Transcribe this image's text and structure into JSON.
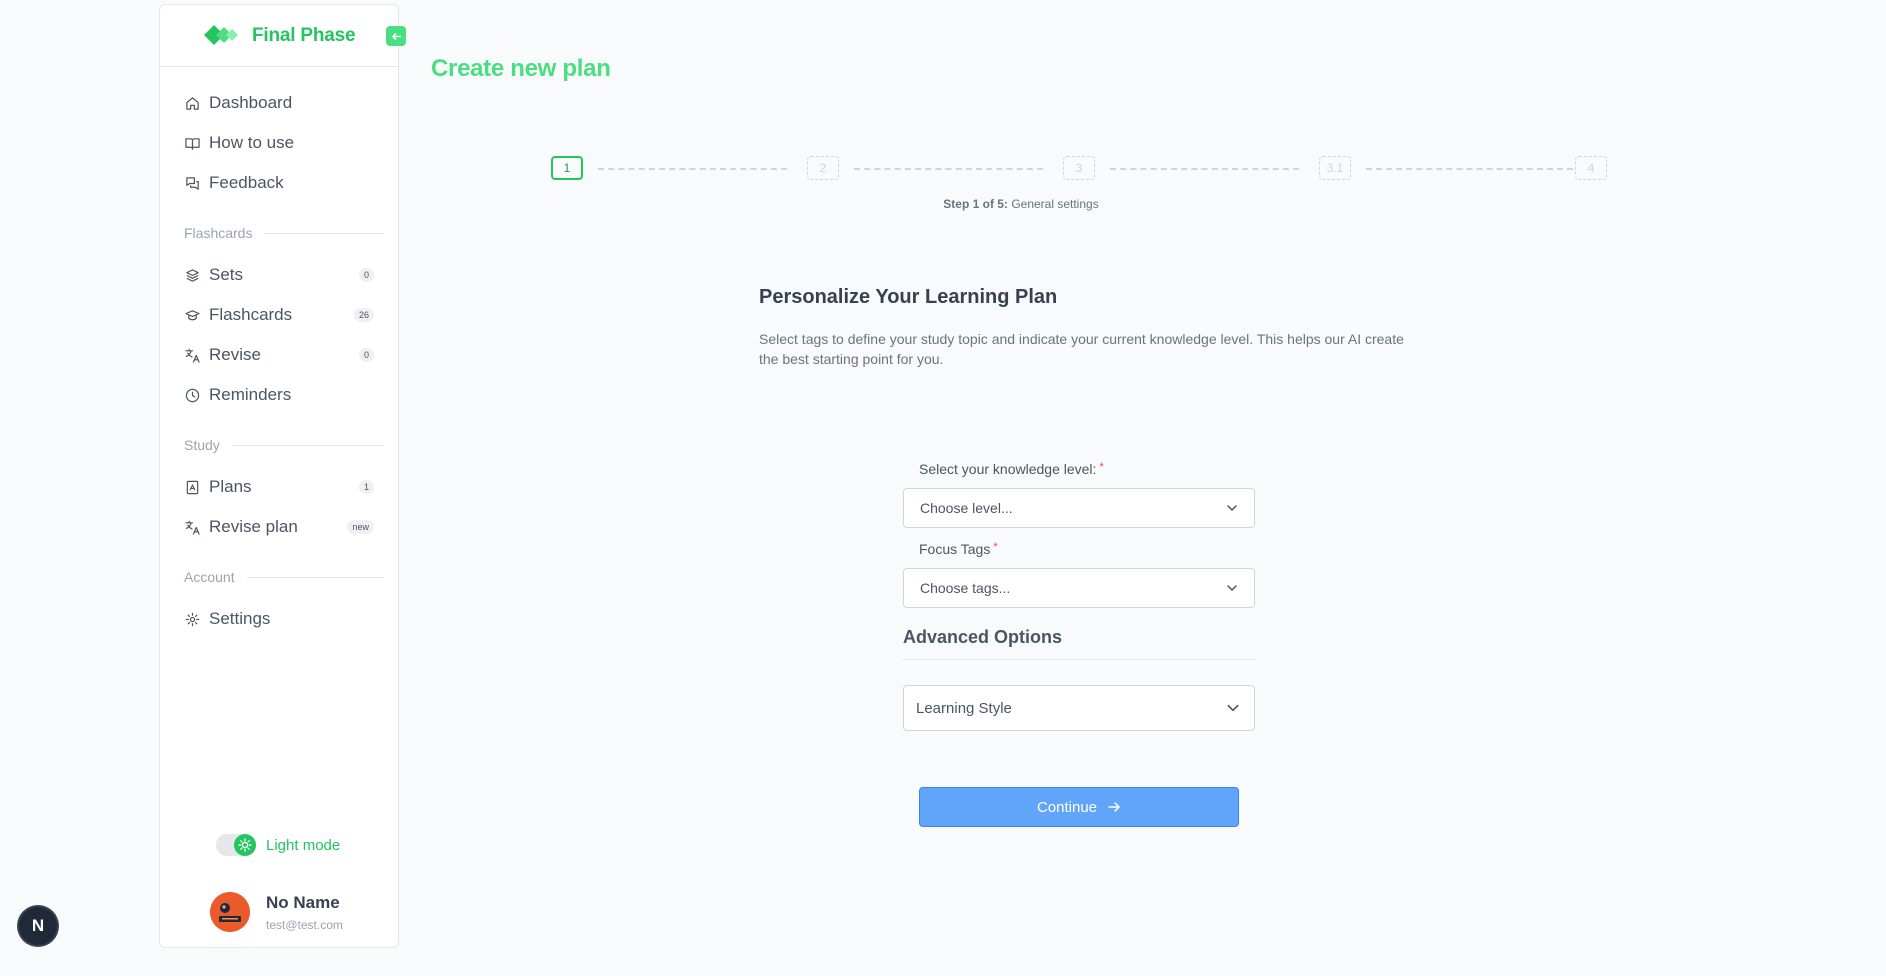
{
  "brand": {
    "name": "Final Phase"
  },
  "sidebar": {
    "items": [
      {
        "label": "Dashboard",
        "icon": "home-icon"
      },
      {
        "label": "How to use",
        "icon": "book-icon"
      },
      {
        "label": "Feedback",
        "icon": "chat-icon"
      }
    ],
    "sections": [
      {
        "title": "Flashcards",
        "items": [
          {
            "label": "Sets",
            "badge": "0",
            "icon": "layers-icon"
          },
          {
            "label": "Flashcards",
            "badge": "26",
            "icon": "graduation-cap-icon"
          },
          {
            "label": "Revise",
            "badge": "0",
            "icon": "translate-icon"
          },
          {
            "label": "Reminders",
            "icon": "clock-icon"
          }
        ]
      },
      {
        "title": "Study",
        "items": [
          {
            "label": "Plans",
            "badge": "1",
            "icon": "notebook-icon"
          },
          {
            "label": "Revise plan",
            "badge": "new",
            "icon": "translate-icon"
          }
        ]
      },
      {
        "title": "Account",
        "items": [
          {
            "label": "Settings",
            "icon": "gear-icon"
          }
        ]
      }
    ],
    "theme_label": "Light mode",
    "user": {
      "name": "No Name",
      "email": "test@test.com"
    }
  },
  "dev_badge": "N",
  "page": {
    "title": "Create new plan"
  },
  "stepper": {
    "steps": [
      "1",
      "2",
      "3",
      "3.1",
      "4"
    ],
    "active_index": 0,
    "caption_bold": "Step 1 of 5:",
    "caption": "General settings"
  },
  "intro": {
    "title": "Personalize Your Learning Plan",
    "text": "Select tags to define your study topic and indicate your current knowledge level. This helps our AI create the best starting point for you."
  },
  "form": {
    "knowledge_label": "Select your knowledge level:",
    "knowledge_placeholder": "Choose level...",
    "tags_label": "Focus Tags",
    "tags_placeholder": "Choose tags...",
    "required_mark": "*",
    "advanced_title": "Advanced Options",
    "learning_style": "Learning Style",
    "continue_label": "Continue"
  },
  "colors": {
    "brand_green": "#22c55e",
    "button_blue": "#60a5fa",
    "required_red": "#ef4444"
  }
}
